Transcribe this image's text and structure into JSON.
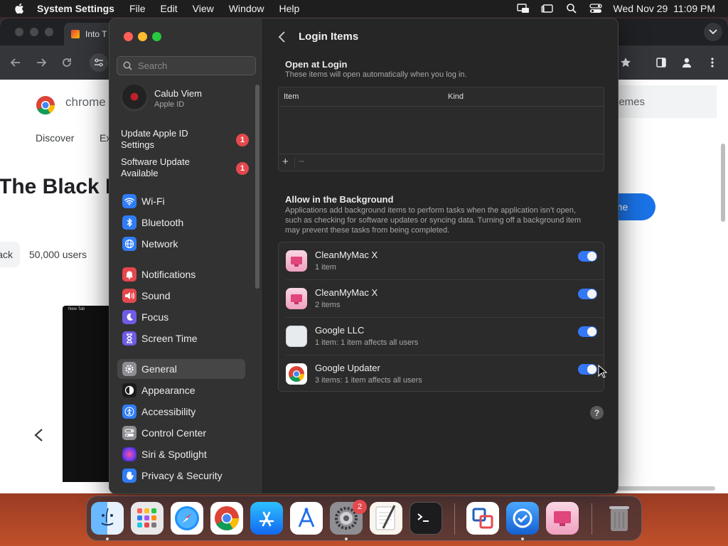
{
  "menubar": {
    "app_name": "System Settings",
    "menus": [
      "File",
      "Edit",
      "View",
      "Window",
      "Help"
    ],
    "clock": "Wed Nov 29  11:09 PM"
  },
  "browser": {
    "tab_title": "Into T",
    "logo_text": "chrome",
    "nav": [
      "Discover",
      "Ex"
    ],
    "hero_title": "The Black I",
    "pill_text": "ack",
    "users": "50,000 users",
    "themes": "hemes",
    "cta": "ome",
    "preview_tab": "New Tab"
  },
  "settings": {
    "search_placeholder": "Search",
    "account": {
      "name": "Calub Viem",
      "subtitle": "Apple ID"
    },
    "notices": [
      {
        "label": "Update Apple ID Settings",
        "badge": "1"
      },
      {
        "label": "Software Update Available",
        "badge": "1"
      }
    ],
    "sidebar": [
      {
        "label": "Wi-Fi",
        "icon": "wifi-icon",
        "color": "#2f7cf6"
      },
      {
        "label": "Bluetooth",
        "icon": "bluetooth-icon",
        "color": "#2f7cf6"
      },
      {
        "label": "Network",
        "icon": "globe-icon",
        "color": "#2f7cf6"
      },
      {
        "label": "Notifications",
        "icon": "bell-icon",
        "color": "#e5484d"
      },
      {
        "label": "Sound",
        "icon": "speaker-icon",
        "color": "#e5484d"
      },
      {
        "label": "Focus",
        "icon": "moon-icon",
        "color": "#6e5ce6"
      },
      {
        "label": "Screen Time",
        "icon": "hourglass-icon",
        "color": "#6e5ce6"
      },
      {
        "label": "General",
        "icon": "gear-icon",
        "color": "#8e8e93"
      },
      {
        "label": "Appearance",
        "icon": "appearance-icon",
        "color": "#1c1c1e"
      },
      {
        "label": "Accessibility",
        "icon": "accessibility-icon",
        "color": "#2f7cf6"
      },
      {
        "label": "Control Center",
        "icon": "control-center-icon",
        "color": "#8e8e93"
      },
      {
        "label": "Siri & Spotlight",
        "icon": "siri-icon",
        "color": "#c040c0"
      },
      {
        "label": "Privacy & Security",
        "icon": "hand-icon",
        "color": "#2f7cf6"
      }
    ],
    "selected_item": "General",
    "page_title": "Login Items",
    "open_at_login": {
      "title": "Open at Login",
      "description": "These items will open automatically when you log in.",
      "columns": [
        "Item",
        "Kind"
      ],
      "add_label": "+",
      "remove_label": "−"
    },
    "background": {
      "title": "Allow in the Background",
      "description": "Applications add background items to perform tasks when the application isn’t open, such as checking for software updates or syncing data. Turning off a background item may prevent these tasks from being completed.",
      "items": [
        {
          "name": "CleanMyMac X",
          "detail": "1 item",
          "enabled": true,
          "icon": "cleanmymac-icon"
        },
        {
          "name": "CleanMyMac X",
          "detail": "2 items",
          "enabled": true,
          "icon": "cleanmymac-icon"
        },
        {
          "name": "Google LLC",
          "detail": "1 item: 1 item affects all users",
          "enabled": true,
          "icon": "generic-app-icon"
        },
        {
          "name": "Google Updater",
          "detail": "3 items: 1 item affects all users",
          "enabled": true,
          "icon": "chrome-icon"
        }
      ]
    },
    "help_label": "?"
  },
  "dock": {
    "apps": [
      "finder-icon",
      "launchpad-icon",
      "safari-icon",
      "chrome-icon",
      "app-store-icon",
      "xcode-instruments-icon",
      "system-settings-icon",
      "textedit-icon",
      "terminal-icon",
      "screens-icon",
      "proxyman-icon",
      "cleanmymac-icon",
      "trash-icon"
    ],
    "settings_badge": "2"
  }
}
